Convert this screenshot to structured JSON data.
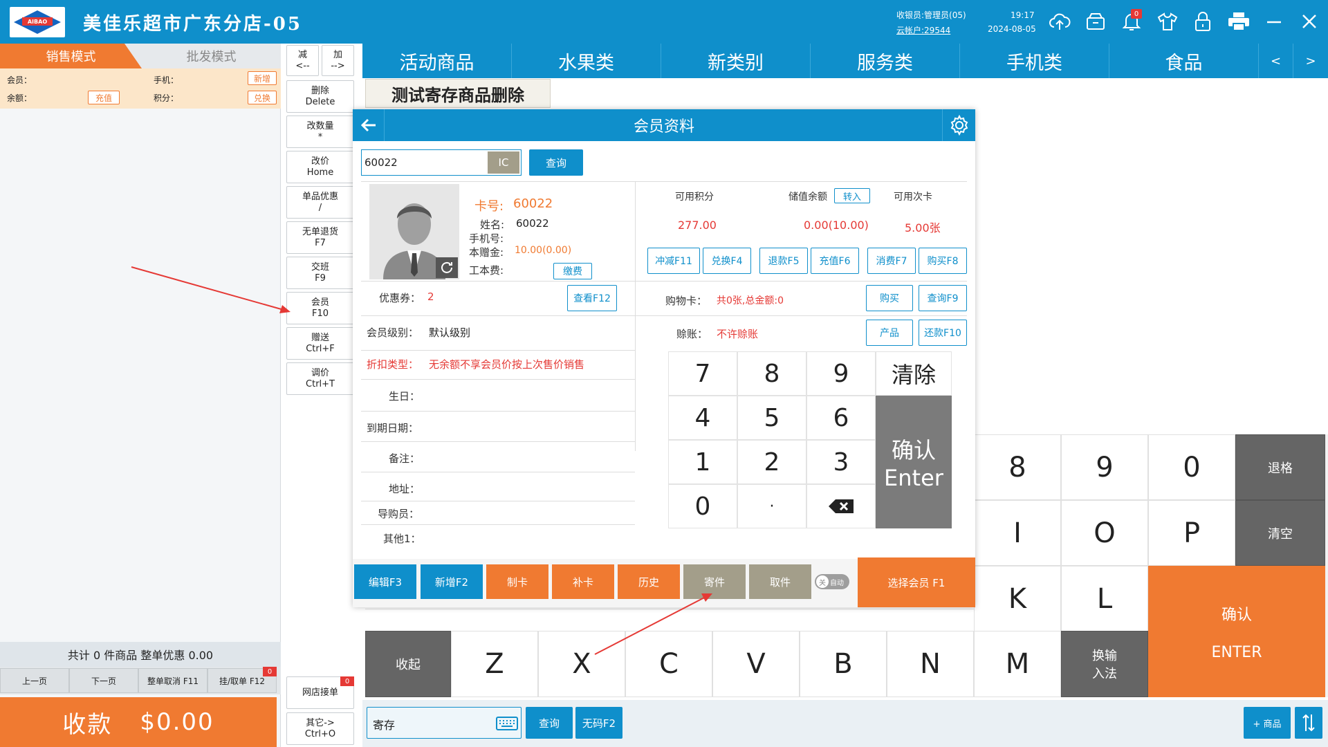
{
  "topbar": {
    "logo_text": "AIBAO 爱宝",
    "store_title": "美佳乐超市广东分店-05",
    "cashier": "收银员:管理员(05)",
    "cloud_account": "云帐户:29544",
    "time": "19:17",
    "date": "2024-08-05",
    "notification_count": "0",
    "icons": [
      "cloud-upload-icon",
      "cash-drawer-icon",
      "bell-icon",
      "shirt-icon",
      "lock-icon",
      "printer-icon",
      "minimize-icon",
      "close-icon"
    ]
  },
  "left": {
    "tab_sale": "销售模式",
    "tab_wholesale": "批发模式",
    "member_label": "会员：",
    "phone_label": "手机：",
    "add_btn": "新增",
    "balance_label": "余额：",
    "recharge_btn": "充值",
    "points_label": "积分：",
    "redeem_btn": "兑换",
    "summary": "共计 0 件商品 整单优惠 0.00",
    "prev_page": "上一页",
    "next_page": "下一页",
    "cancel_order": "整单取消 F11",
    "hold_order": "挂/取单 F12",
    "hold_count": "0",
    "pay_label": "收款",
    "pay_amount": "$0.00"
  },
  "functions": {
    "minus": "减",
    "minus_arrow": "<--",
    "plus": "加",
    "plus_arrow": "-->",
    "buttons": [
      {
        "l1": "删除",
        "l2": "Delete"
      },
      {
        "l1": "改数量",
        "l2": "*"
      },
      {
        "l1": "改价",
        "l2": "Home"
      },
      {
        "l1": "单品优惠",
        "l2": "/"
      },
      {
        "l1": "无单退货",
        "l2": "F7"
      },
      {
        "l1": "交班",
        "l2": "F9"
      },
      {
        "l1": "会员",
        "l2": "F10"
      },
      {
        "l1": "赠送",
        "l2": "Ctrl+F"
      },
      {
        "l1": "调价",
        "l2": "Ctrl+T"
      }
    ],
    "online_orders": "网店接单",
    "online_count": "0",
    "other_l1": "其它->",
    "other_l2": "Ctrl+O"
  },
  "categories": [
    "活动商品",
    "水果类",
    "新类别",
    "服务类",
    "手机类",
    "食品"
  ],
  "cat_prev": "<",
  "cat_next": ">",
  "product_title": "测试寄存商品删除",
  "dialog": {
    "title": "会员资料",
    "search_value": "60022",
    "ic_btn": "IC",
    "query_btn": "查询",
    "card_label": "卡号:",
    "card_no": "60022",
    "name_label": "姓名:",
    "name": "60022",
    "phone_label": "手机号:",
    "gift_label": "本赠金:",
    "gift_value": "10.00(0.00)",
    "cost_label": "工本费:",
    "pay_fee_btn": "缴费",
    "points_label": "可用积分",
    "points": "277.00",
    "stored_label": "储值余额",
    "transfer_btn": "转入",
    "stored": "0.00(10.00)",
    "times_label": "可用次卡",
    "times": "5.00张",
    "ops": [
      "冲减F11",
      "兑换F4",
      "退款F5",
      "充值F6",
      "消费F7",
      "购买F8"
    ],
    "coupon_label": "优惠券：",
    "coupon_value": "2",
    "view_btn": "查看F12",
    "shopcard_label": "购物卡：",
    "shopcard_value": "共0张,总金额:0",
    "buy_btn": "购买",
    "query9_btn": "查询F9",
    "level_label": "会员级别：",
    "level_value": "默认级别",
    "credit_label": "赊账：",
    "credit_value": "不许赊账",
    "product_btn": "产品",
    "repay_btn": "还款F10",
    "discount_label": "折扣类型：",
    "discount_value": "无余额不享会员价按上次售价销售",
    "fields": [
      "生日：",
      "到期日期：",
      "备注：",
      "地址：",
      "导购员：",
      "其他1："
    ],
    "numpad": [
      "7",
      "8",
      "9",
      "4",
      "5",
      "6",
      "1",
      "2",
      "3",
      "0",
      "·"
    ],
    "clear": "清除",
    "confirm_l1": "确认",
    "confirm_l2": "Enter",
    "actions": [
      {
        "label": "编辑F3",
        "color": "#0f8fcb"
      },
      {
        "label": "新增F2",
        "color": "#0f8fcb"
      },
      {
        "label": "制卡",
        "color": "#f07a31"
      },
      {
        "label": "补卡",
        "color": "#f07a31"
      },
      {
        "label": "历史",
        "color": "#f07a31"
      },
      {
        "label": "寄件",
        "color": "#a39e8a"
      },
      {
        "label": "取件",
        "color": "#a39e8a"
      }
    ],
    "toggle_off": "关",
    "toggle_label": "自动",
    "select_member": "选择会员 F1"
  },
  "keyboard": {
    "row1": [
      "8",
      "9",
      "0"
    ],
    "backspace": "退格",
    "row2": [
      "I",
      "O",
      "P"
    ],
    "clear": "清空",
    "row3": [
      "K",
      "L"
    ],
    "confirm_l1": "确认",
    "confirm_l2": "ENTER",
    "collapse": "收起",
    "row4": [
      "Z",
      "X",
      "C",
      "V",
      "B",
      "N",
      "M"
    ],
    "ime_l1": "换输",
    "ime_l2": "入法"
  },
  "bottom": {
    "input_value": "寄存",
    "query_btn": "查询",
    "nocode_btn": "无码F2",
    "add_product": "+ 商品"
  }
}
